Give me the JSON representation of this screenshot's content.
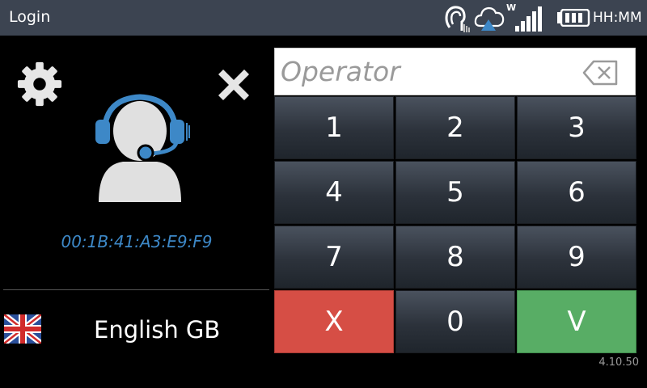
{
  "statusbar": {
    "title": "Login",
    "network_label": "W",
    "clock": "HH:MM",
    "icons": [
      "nfc-reader-icon",
      "cloud-upload-icon",
      "signal-strength-icon",
      "battery-icon"
    ]
  },
  "profile": {
    "mac_address": "00:1B:41:A3:E9:F9",
    "icon": "operator-headset-icon"
  },
  "language": {
    "label": "English GB",
    "flag": "uk-flag-icon"
  },
  "operator_input": {
    "placeholder": "Operator",
    "value": ""
  },
  "keypad": {
    "keys": [
      "1",
      "2",
      "3",
      "4",
      "5",
      "6",
      "7",
      "8",
      "9",
      "X",
      "0",
      "V"
    ]
  },
  "version": "4.10.50",
  "colors": {
    "statusbar_bg": "#3c4451",
    "accent_blue": "#3d88c7",
    "cancel_red": "#d64e45",
    "confirm_green": "#58ad65",
    "key_dark": "#2c323b"
  }
}
